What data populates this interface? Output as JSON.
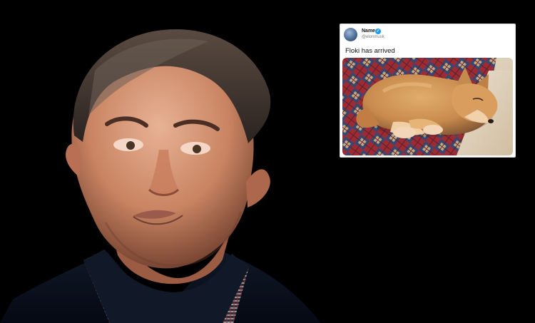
{
  "tweet": {
    "name": "Name",
    "handle": "@elonmusk",
    "text": "Floki has arrived",
    "verified_color": "#1d9bf0",
    "icons": [
      "verified-icon",
      "avatar"
    ]
  },
  "colors": {
    "background": "#000000",
    "card_background": "#ffffff"
  }
}
